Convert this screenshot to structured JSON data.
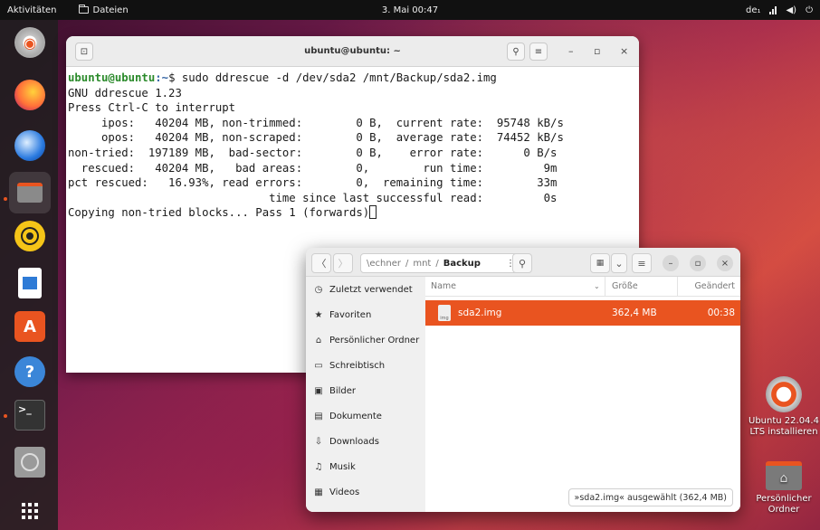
{
  "topbar": {
    "activities": "Aktivitäten",
    "app_name": "Dateien",
    "clock": "3. Mai 00:47",
    "language": "de₁"
  },
  "dock": {
    "items": [
      "ubuntu-installer",
      "firefox",
      "thunderbird",
      "files",
      "rhythmbox",
      "libreoffice-writer",
      "app-center",
      "help",
      "terminal",
      "disc",
      "show-apps"
    ]
  },
  "terminal": {
    "title": "ubuntu@ubuntu: ~",
    "prompt_user": "ubuntu@ubuntu",
    "prompt_path": ":~",
    "prompt_symbol": "$ ",
    "command": "sudo ddrescue -d /dev/sda2 /mnt/Backup/sda2.img",
    "output": [
      "GNU ddrescue 1.23",
      "Press Ctrl-C to interrupt",
      "     ipos:   40204 MB, non-trimmed:        0 B,  current rate:  95748 kB/s",
      "     opos:   40204 MB, non-scraped:        0 B,  average rate:  74452 kB/s",
      "non-tried:  197189 MB,  bad-sector:        0 B,    error rate:      0 B/s",
      "  rescued:   40204 MB,   bad areas:        0,        run time:         9m",
      "pct rescued:   16.93%, read errors:        0,  remaining time:        33m",
      "                              time since last successful read:         0s",
      "Copying non-tried blocks... Pass 1 (forwards)"
    ]
  },
  "files": {
    "path_prefix": "\\echner",
    "path_mid": "mnt",
    "path_current": "Backup",
    "sidebar": [
      {
        "icon": "clock-icon",
        "glyph": "◷",
        "label": "Zuletzt verwendet"
      },
      {
        "icon": "star-icon",
        "glyph": "★",
        "label": "Favoriten"
      },
      {
        "icon": "home-icon",
        "glyph": "⌂",
        "label": "Persönlicher Ordner"
      },
      {
        "icon": "desktop-icon",
        "glyph": "▭",
        "label": "Schreibtisch"
      },
      {
        "icon": "pictures-icon",
        "glyph": "▣",
        "label": "Bilder"
      },
      {
        "icon": "documents-icon",
        "glyph": "▤",
        "label": "Dokumente"
      },
      {
        "icon": "downloads-icon",
        "glyph": "⇩",
        "label": "Downloads"
      },
      {
        "icon": "music-icon",
        "glyph": "♫",
        "label": "Musik"
      },
      {
        "icon": "videos-icon",
        "glyph": "▦",
        "label": "Videos"
      }
    ],
    "columns": {
      "name": "Name",
      "size": "Größe",
      "modified": "Geändert"
    },
    "rows": [
      {
        "name": "sda2.img",
        "size": "362,4 MB",
        "modified": "00:38",
        "icon_text": "img"
      }
    ],
    "status": "»sda2.img« ausgewählt (362,4 MB)"
  },
  "desktop": {
    "install_label_1": "Ubuntu 22.04.4",
    "install_label_2": "LTS installieren",
    "home_label_1": "Persönlicher",
    "home_label_2": "Ordner"
  }
}
